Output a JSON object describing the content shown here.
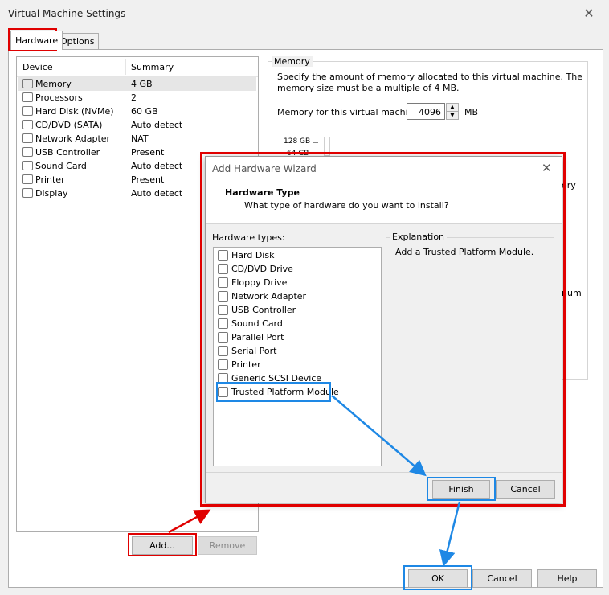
{
  "window": {
    "title": "Virtual Machine Settings"
  },
  "tabs": [
    {
      "label": "Hardware"
    },
    {
      "label": "Options"
    }
  ],
  "device_table": {
    "headers": {
      "device": "Device",
      "summary": "Summary"
    },
    "rows": [
      {
        "device": "Memory",
        "summary": "4 GB",
        "icon": "memory-icon"
      },
      {
        "device": "Processors",
        "summary": "2",
        "icon": "processor-icon"
      },
      {
        "device": "Hard Disk (NVMe)",
        "summary": "60 GB",
        "icon": "hard-disk-icon"
      },
      {
        "device": "CD/DVD (SATA)",
        "summary": "Auto detect",
        "icon": "cd-dvd-icon"
      },
      {
        "device": "Network Adapter",
        "summary": "NAT",
        "icon": "network-adapter-icon"
      },
      {
        "device": "USB Controller",
        "summary": "Present",
        "icon": "usb-icon"
      },
      {
        "device": "Sound Card",
        "summary": "Auto detect",
        "icon": "sound-card-icon"
      },
      {
        "device": "Printer",
        "summary": "Present",
        "icon": "printer-icon"
      },
      {
        "device": "Display",
        "summary": "Auto detect",
        "icon": "display-icon"
      }
    ]
  },
  "buttons": {
    "add": "Add...",
    "remove": "Remove",
    "ok": "OK",
    "cancel": "Cancel",
    "help": "Help"
  },
  "memory": {
    "group_label": "Memory",
    "description": "Specify the amount of memory allocated to this virtual machine. The memory size must be a multiple of 4 MB.",
    "field_label": "Memory for this virtual machine:",
    "value": "4096",
    "unit": "MB",
    "slider_top_label": "128 GB",
    "slider_second_label": "64 GB",
    "partial_text_1": "ory",
    "partial_text_2": "num"
  },
  "wizard": {
    "title": "Add Hardware Wizard",
    "heading": "Hardware Type",
    "subheading": "What type of hardware do you want to install?",
    "list_label": "Hardware types:",
    "items": [
      {
        "label": "Hard Disk",
        "icon": "hard-disk-icon"
      },
      {
        "label": "CD/DVD Drive",
        "icon": "cd-dvd-icon"
      },
      {
        "label": "Floppy Drive",
        "icon": "floppy-icon"
      },
      {
        "label": "Network Adapter",
        "icon": "network-adapter-icon"
      },
      {
        "label": "USB Controller",
        "icon": "usb-icon"
      },
      {
        "label": "Sound Card",
        "icon": "sound-card-icon"
      },
      {
        "label": "Parallel Port",
        "icon": "parallel-port-icon"
      },
      {
        "label": "Serial Port",
        "icon": "serial-port-icon"
      },
      {
        "label": "Printer",
        "icon": "printer-icon"
      },
      {
        "label": "Generic SCSI Device",
        "icon": "scsi-icon"
      },
      {
        "label": "Trusted Platform Module",
        "icon": "tpm-icon"
      }
    ],
    "selected_item": "Trusted Platform Module",
    "explanation_label": "Explanation",
    "explanation_text": "Add a Trusted Platform Module.",
    "finish": "Finish",
    "cancel": "Cancel"
  },
  "annotation_colors": {
    "red": "#e00000",
    "blue": "#1e88e5"
  }
}
